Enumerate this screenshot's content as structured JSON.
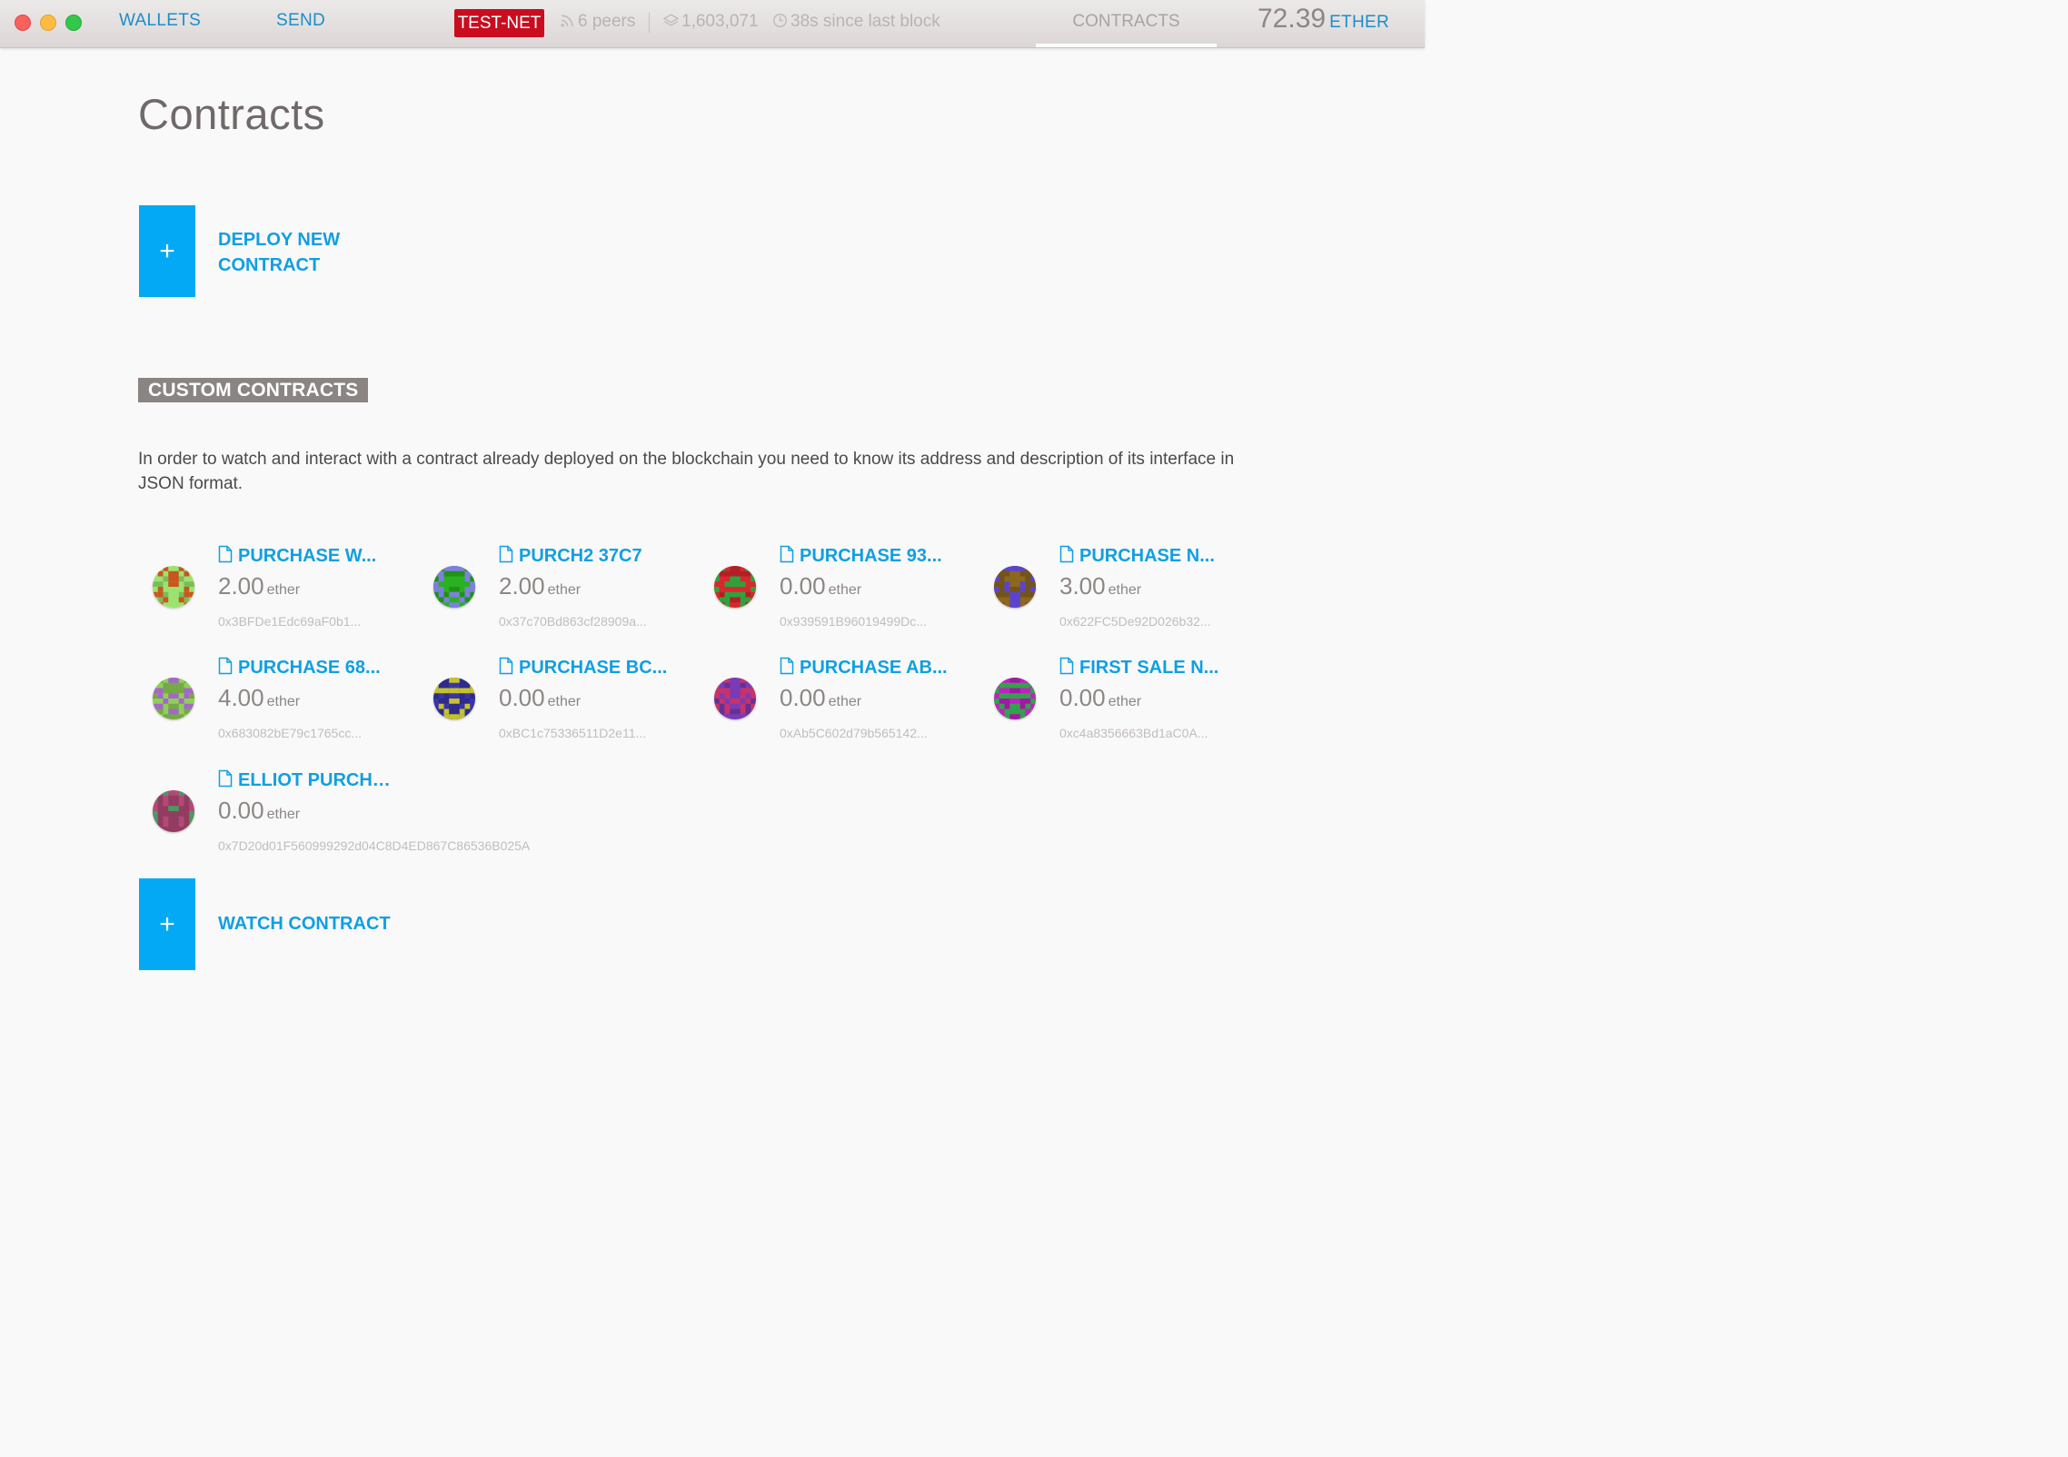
{
  "nav": {
    "wallets": "WALLETS",
    "send": "SEND",
    "network": "TEST-NET",
    "peers": "6 peers",
    "block": "1,603,071",
    "since": "38s since last block",
    "contracts": "CONTRACTS",
    "balance_amount": "72.39",
    "balance_unit": "ETHER"
  },
  "page": {
    "title": "Contracts",
    "deploy_line1": "DEPLOY NEW",
    "deploy_line2": "CONTRACT",
    "plus": "+",
    "section_label": "CUSTOM CONTRACTS",
    "description": "In order to watch and interact with a contract already deployed on the blockchain you need to know its address and description of its interface in JSON format.",
    "watch_label": "WATCH CONTRACT"
  },
  "contracts": [
    {
      "name": "PURCHASE W...",
      "balance": "2.00",
      "unit": "ether",
      "address": "0x3BFDe1Edc69aF0b1...",
      "colors": [
        "#9be36f",
        "#c8561f"
      ]
    },
    {
      "name": "PURCH2 37C7",
      "balance": "2.00",
      "unit": "ether",
      "address": "0x37c70Bd863cf28909a...",
      "colors": [
        "#2ab11f",
        "#7f7fe0"
      ]
    },
    {
      "name": "PURCHASE 93...",
      "balance": "0.00",
      "unit": "ether",
      "address": "0x939591B96019499Dc...",
      "colors": [
        "#d8282f",
        "#2ea33b"
      ]
    },
    {
      "name": "PURCHASE N...",
      "balance": "3.00",
      "unit": "ether",
      "address": "0x622FC5De92D026b32...",
      "colors": [
        "#8b6720",
        "#5b43d1"
      ]
    },
    {
      "name": "PURCHASE 68...",
      "balance": "4.00",
      "unit": "ether",
      "address": "0x683082bE79c1765cc...",
      "colors": [
        "#8fcf57",
        "#a466c9"
      ]
    },
    {
      "name": "PURCHASE BC...",
      "balance": "0.00",
      "unit": "ether",
      "address": "0xBC1c75336511D2e11...",
      "colors": [
        "#3935a8",
        "#c5c22c"
      ]
    },
    {
      "name": "PURCHASE AB...",
      "balance": "0.00",
      "unit": "ether",
      "address": "0xAb5C602d79b565142...",
      "colors": [
        "#7a3bb7",
        "#c73369"
      ]
    },
    {
      "name": "FIRST SALE N...",
      "balance": "0.00",
      "unit": "ether",
      "address": "0xc4a8356663Bd1aC0A...",
      "colors": [
        "#c21fc6",
        "#33a24a"
      ]
    },
    {
      "name": "ELLIOT PURCHASE",
      "balance": "0.00",
      "unit": "ether",
      "address": "0x7D20d01F560999292d04C8D4ED867C86536B025A",
      "colors": [
        "#b24a78",
        "#4b9a5f"
      ]
    }
  ]
}
